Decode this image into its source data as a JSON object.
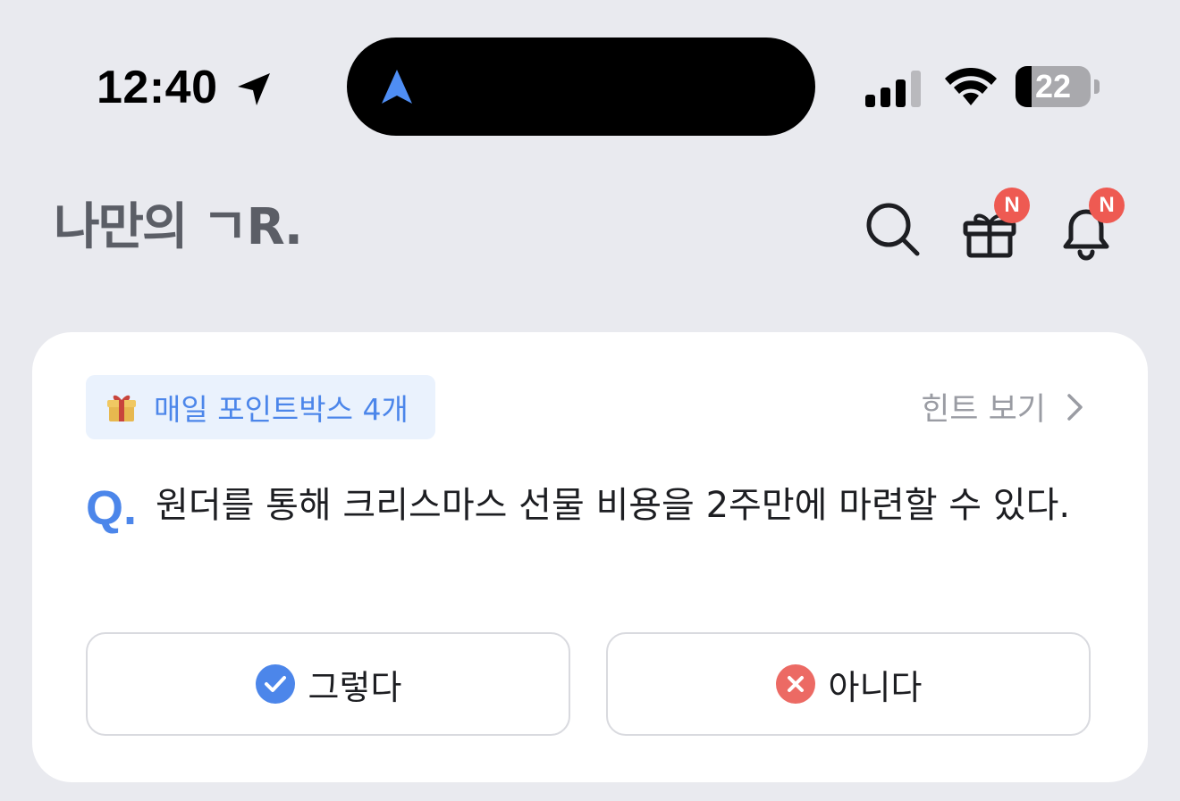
{
  "status_bar": {
    "time": "12:40",
    "battery_level": "22",
    "battery_fraction": 0.22
  },
  "header": {
    "logo": "나만의 ㄱR.",
    "search_icon": "search-icon",
    "gift_badge": "N",
    "bell_badge": "N"
  },
  "quiz": {
    "point_chip_label": "매일 포인트박스 4개",
    "hint_label": "힌트 보기",
    "question_prefix": "Q.",
    "question_text": "원더를 통해 크리스마스 선물 비용을 2주만에 마련할 수 있다.",
    "answers": [
      {
        "label": "그렇다",
        "icon": "check-circle-icon"
      },
      {
        "label": "아니다",
        "icon": "x-circle-icon"
      }
    ]
  },
  "colors": {
    "background": "#e9eaef",
    "accent_blue": "#4c86ea",
    "badge_red": "#ee5a52",
    "chip_bg": "#eaf2fd",
    "no_red": "#ec6a64"
  }
}
